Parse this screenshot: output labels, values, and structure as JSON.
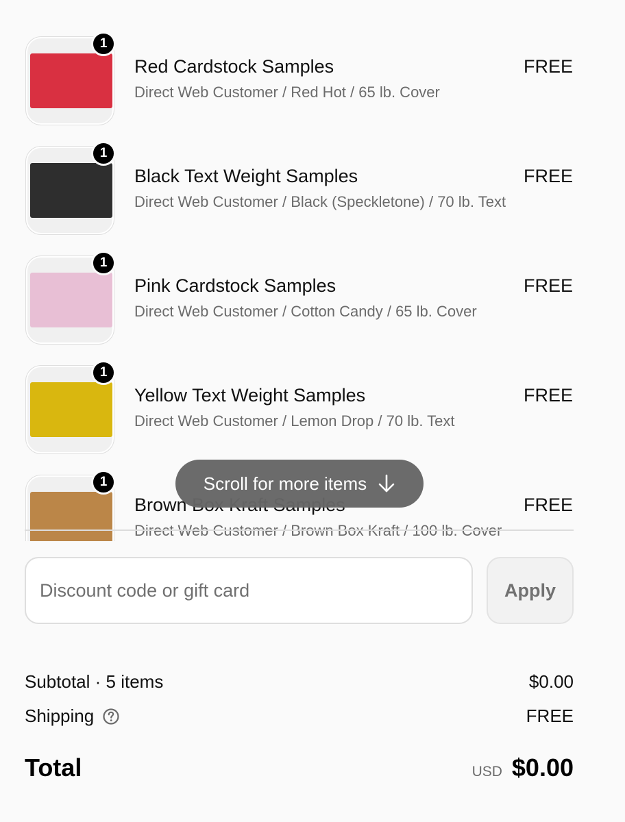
{
  "items": [
    {
      "name": "Red Cardstock Samples",
      "variant": "Direct Web Customer / Red Hot / 65 lb. Cover",
      "price": "FREE",
      "quantity": "1",
      "swatch_color": "#d93041"
    },
    {
      "name": "Black Text Weight Samples",
      "variant": "Direct Web Customer / Black (Speckletone) / 70 lb. Text",
      "price": "FREE",
      "quantity": "1",
      "swatch_color": "#2e2e2e"
    },
    {
      "name": "Pink Cardstock Samples",
      "variant": "Direct Web Customer / Cotton Candy / 65 lb. Cover",
      "price": "FREE",
      "quantity": "1",
      "swatch_color": "#e8bfd5"
    },
    {
      "name": "Yellow Text Weight Samples",
      "variant": "Direct Web Customer / Lemon Drop / 70 lb. Text",
      "price": "FREE",
      "quantity": "1",
      "swatch_color": "#d9b70f"
    },
    {
      "name": "Brown Box Kraft Samples",
      "variant": "Direct Web Customer / Brown Box Kraft / 100 lb. Cover",
      "price": "FREE",
      "quantity": "1",
      "swatch_color": "#bb8648"
    }
  ],
  "scroll_hint": {
    "label": "Scroll for more items",
    "icon": "arrow-down-icon"
  },
  "discount": {
    "placeholder": "Discount code or gift card",
    "value": "",
    "apply_label": "Apply"
  },
  "summary": {
    "subtotal_label": "Subtotal · 5 items",
    "subtotal_value": "$0.00",
    "shipping_label": "Shipping",
    "shipping_help_icon": "question-circle-icon",
    "shipping_value": "FREE",
    "total_label": "Total",
    "currency": "USD",
    "total_value": "$0.00"
  }
}
